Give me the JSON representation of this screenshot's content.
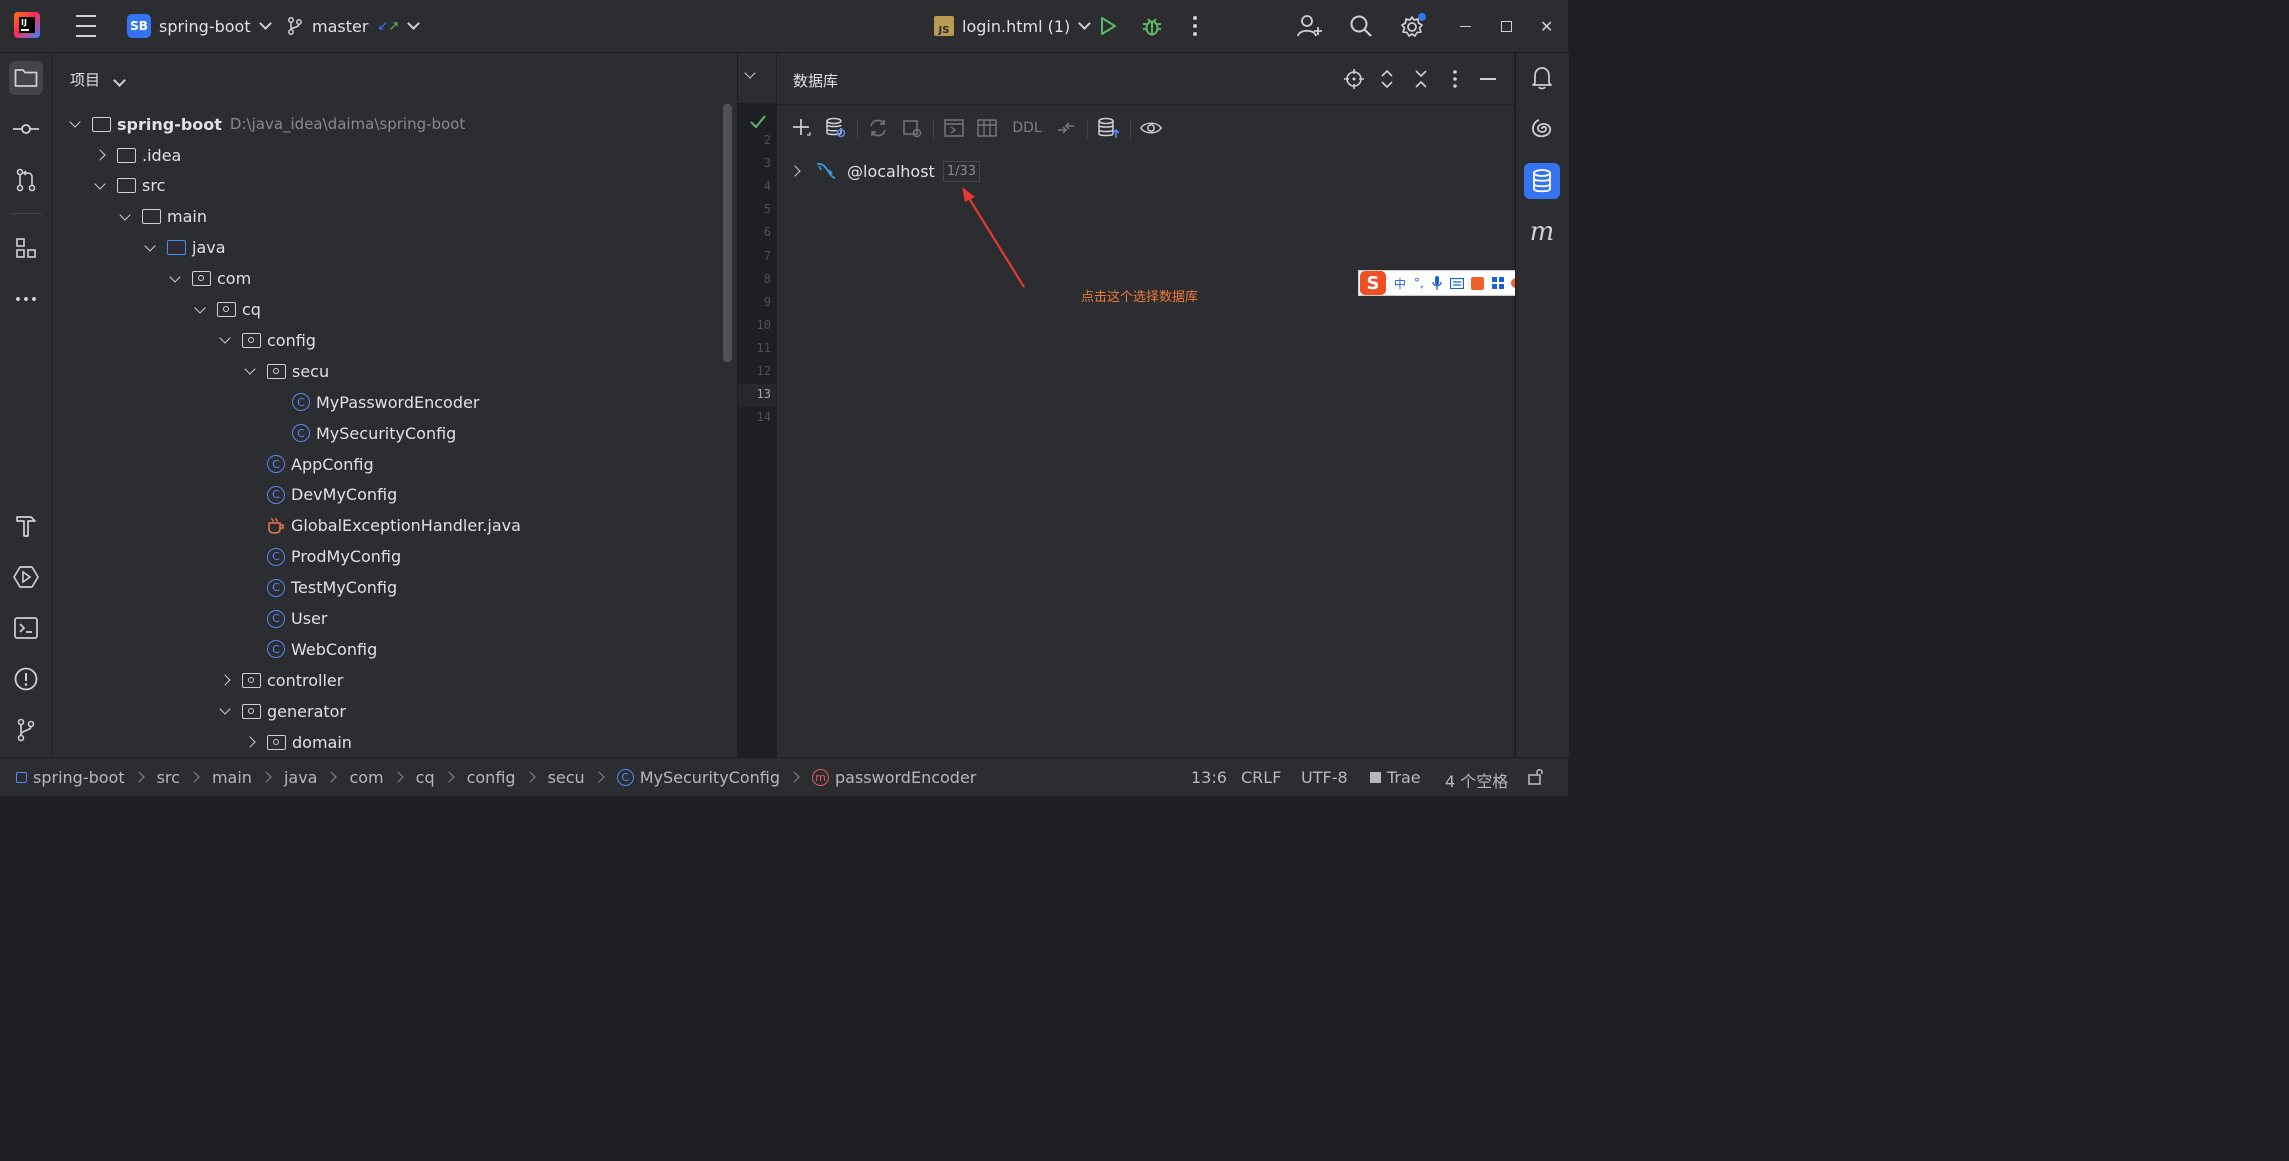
{
  "titlebar": {
    "project_badge": "SB",
    "project_name": "spring-boot",
    "branch": "master",
    "run_config_badge": "JS",
    "run_config": "login.html (1)"
  },
  "project_panel": {
    "title": "项目",
    "root_name": "spring-boot",
    "root_path": "D:\\java_idea\\daima\\spring-boot",
    "items": [
      {
        "label": ".idea",
        "kind": "folder",
        "depth": 1,
        "expanded": false
      },
      {
        "label": "src",
        "kind": "folder",
        "depth": 1,
        "expanded": true
      },
      {
        "label": "main",
        "kind": "folder",
        "depth": 2,
        "expanded": true
      },
      {
        "label": "java",
        "kind": "src",
        "depth": 3,
        "expanded": true
      },
      {
        "label": "com",
        "kind": "pkg",
        "depth": 4,
        "expanded": true
      },
      {
        "label": "cq",
        "kind": "pkg",
        "depth": 5,
        "expanded": true
      },
      {
        "label": "config",
        "kind": "pkg",
        "depth": 6,
        "expanded": true
      },
      {
        "label": "secu",
        "kind": "pkg",
        "depth": 7,
        "expanded": true
      },
      {
        "label": "MyPasswordEncoder",
        "kind": "class",
        "depth": 8
      },
      {
        "label": "MySecurityConfig",
        "kind": "class",
        "depth": 8
      },
      {
        "label": "AppConfig",
        "kind": "class",
        "depth": 7
      },
      {
        "label": "DevMyConfig",
        "kind": "class",
        "depth": 7
      },
      {
        "label": "GlobalExceptionHandler.java",
        "kind": "java",
        "depth": 7
      },
      {
        "label": "ProdMyConfig",
        "kind": "class",
        "depth": 7
      },
      {
        "label": "TestMyConfig",
        "kind": "class",
        "depth": 7
      },
      {
        "label": "User",
        "kind": "class",
        "depth": 7
      },
      {
        "label": "WebConfig",
        "kind": "class",
        "depth": 7
      },
      {
        "label": "controller",
        "kind": "pkg",
        "depth": 6,
        "expanded": false
      },
      {
        "label": "generator",
        "kind": "pkg",
        "depth": 6,
        "expanded": true
      },
      {
        "label": "domain",
        "kind": "pkg",
        "depth": 7,
        "expanded": false
      }
    ]
  },
  "editor_gutter": {
    "lines": [
      "2",
      "3",
      "4",
      "5",
      "6",
      "7",
      "8",
      "9",
      "10",
      "11",
      "12",
      "13",
      "14"
    ],
    "current_line": "13"
  },
  "database_panel": {
    "title": "数据库",
    "ddl_label": "DDL",
    "datasource": "@localhost",
    "datasource_count": "1/33",
    "annotation": "点击这个选择数据库"
  },
  "ime_toolbar": {
    "logo": "S",
    "mode": "中"
  },
  "statusbar": {
    "breadcrumb": [
      "spring-boot",
      "src",
      "main",
      "java",
      "com",
      "cq",
      "config",
      "secu",
      "MySecurityConfig",
      "passwordEncoder"
    ],
    "position": "13:6",
    "line_ending": "CRLF",
    "encoding": "UTF-8",
    "plugin": "Trae",
    "indent": "4 个空格"
  },
  "colors": {
    "accent": "#3574f0",
    "annotation": "#f0793a",
    "arrow": "#e53935",
    "run": "#5fb865"
  },
  "icons": [
    "hamburger-icon",
    "branch-icon",
    "run-icon",
    "debug-icon",
    "more-icon",
    "add-user-icon",
    "search-icon",
    "settings-icon",
    "folder-icon",
    "commit-icon",
    "pull-request-icon",
    "structure-icon",
    "build-icon",
    "services-icon",
    "terminal-icon",
    "problems-icon",
    "git-icon",
    "notifications-icon",
    "ai-icon",
    "database-icon",
    "maven-icon"
  ]
}
